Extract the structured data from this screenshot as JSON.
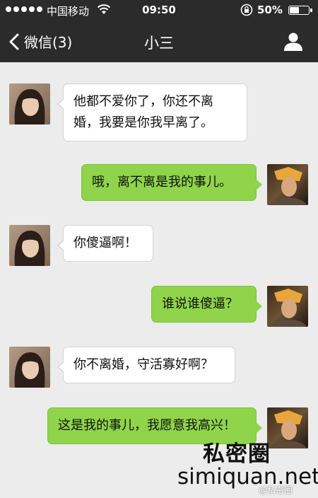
{
  "status_bar": {
    "carrier": "中国移动",
    "time": "09:50",
    "battery_percent": "50%",
    "battery_level": 0.5,
    "signal_icon": "signal-dots-icon",
    "wifi_icon": "wifi-icon",
    "lock_icon": "rotation-lock-icon"
  },
  "nav": {
    "back_label": "微信(3)",
    "title": "小三",
    "profile_icon": "person-icon"
  },
  "colors": {
    "nav_background": "#2b2b2b",
    "chat_background": "#ececec",
    "incoming_bubble": "#ffffff",
    "outgoing_bubble": "#8fd44a"
  },
  "messages": [
    {
      "side": "incoming",
      "text": "他都不爱你了，你还不离婚，我要是你我早离了。"
    },
    {
      "side": "outgoing",
      "text": "哦，离不离是我的事儿。"
    },
    {
      "side": "incoming",
      "text": "你傻逼啊！"
    },
    {
      "side": "outgoing",
      "text": "谁说谁傻逼？"
    },
    {
      "side": "incoming",
      "text": "你不离婚，守活寡好啊？"
    },
    {
      "side": "outgoing",
      "text": "这是我的事儿，我愿意我高兴！"
    }
  ],
  "watermark": {
    "chinese": "私密圈",
    "url": "simiquan.net",
    "weibo": "@私密圈"
  }
}
